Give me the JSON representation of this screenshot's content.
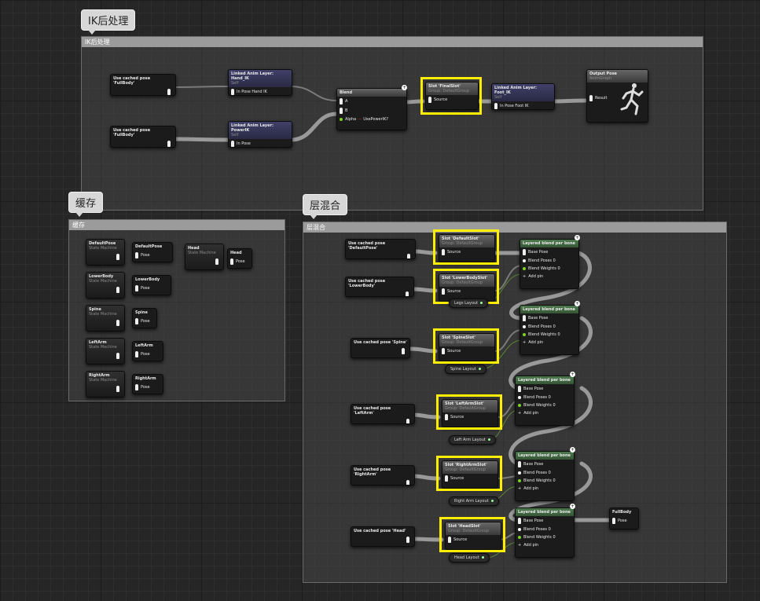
{
  "bubbles": {
    "ik": "IK后处理",
    "cache": "缓存",
    "layer": "层混合"
  },
  "comments": {
    "ik": "IK后处理",
    "cache": "缓存",
    "layer": "层混合"
  },
  "ik": {
    "use1": "Use cached pose 'FullBody'",
    "use2": "Use cached pose 'FullBody'",
    "hand_title": "Linked Anim Layer: Hand_IK",
    "hand_sub": "Self",
    "hand_pin": "In Pose Hand IK",
    "power_title": "Linked Anim Layer: PowerIK",
    "power_sub": "Self",
    "power_pin": "In Pose",
    "blend_title": "Blend",
    "blend_a": "A",
    "blend_b": "B",
    "blend_alpha": "Alpha",
    "blend_use": "UsePowerIK?",
    "slot_title": "Slot 'FinalSlot'",
    "slot_sub": "Group: DefaultGroup",
    "slot_pin": "Source",
    "foot_title": "Linked Anim Layer: Foot_IK",
    "foot_sub": "Self",
    "foot_pin": "In Pose Foot IK",
    "out_title": "Output Pose",
    "out_sub": "AnimGraph",
    "out_pin": "Result"
  },
  "cache": {
    "sms": [
      {
        "name": "DefaultPose",
        "sub": "State Machine",
        "save": "DefaultPose",
        "pin": "Pose"
      },
      {
        "name": "LowerBody",
        "sub": "State Machine",
        "save": "LowerBody",
        "pin": "Pose"
      },
      {
        "name": "Spine",
        "sub": "State Machine",
        "save": "Spine",
        "pin": "Pose"
      },
      {
        "name": "LeftArm",
        "sub": "State Machine",
        "save": "LeftArm",
        "pin": "Pose"
      },
      {
        "name": "RightArm",
        "sub": "State Machine",
        "save": "RightArm",
        "pin": "Pose"
      }
    ],
    "head": {
      "name": "Head",
      "sub": "State Machine",
      "save": "Head",
      "pin": "Pose"
    }
  },
  "layer": {
    "uses": [
      "Use cached pose 'DefaultPose'",
      "Use cached pose 'LowerBody'",
      "Use cached pose 'Spine'",
      "Use cached pose 'LeftArm'",
      "Use cached pose 'RightArm'",
      "Use cached pose 'Head'"
    ],
    "slots": [
      {
        "title": "Slot 'DefaultSlot'",
        "sub": "Group: DefaultGroup",
        "pin": "Source"
      },
      {
        "title": "Slot 'LowerBodySlot'",
        "sub": "Group: DefaultGroup",
        "pin": "Source"
      },
      {
        "title": "Slot 'SpineSlot'",
        "sub": "Group: DefaultGroup",
        "pin": "Source"
      },
      {
        "title": "Slot 'LeftArmSlot'",
        "sub": "Group: DefaultGroup",
        "pin": "Source"
      },
      {
        "title": "Slot 'RightArmSlot'",
        "sub": "Group: DefaultGroup",
        "pin": "Source"
      },
      {
        "title": "Slot 'HeadSlot'",
        "sub": "Group: DefaultGroup",
        "pin": "Source"
      }
    ],
    "layouts": [
      "Legs Layout",
      "Spine Layout",
      "Left Arm Layout",
      "Right Arm Layout",
      "Head Layout"
    ],
    "lb_title": "Layered blend per bone",
    "lb_base": "Base Pose",
    "lb_poses": "Blend Poses 0",
    "lb_weights": "Blend Weights 0",
    "lb_add": "Add pin",
    "full_title": "FullBody",
    "full_pin": "Pose"
  },
  "colors": {
    "highlight": "#ffee00",
    "wire_pose": "#ffffff",
    "wire_float": "#7ed321"
  }
}
